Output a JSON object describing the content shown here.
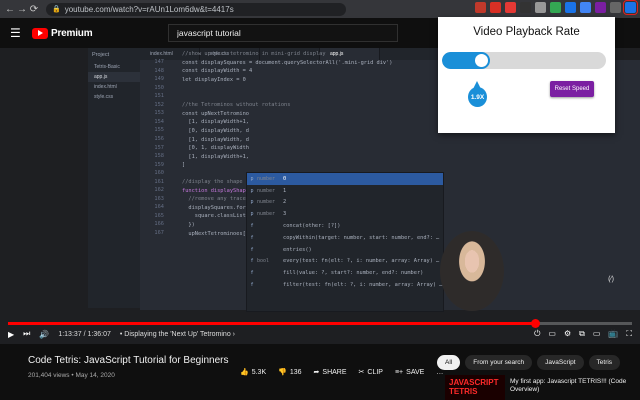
{
  "browser": {
    "url": "youtube.com/watch?v=rAUn1Lom6dw&t=4417s",
    "extensions": [
      {
        "icon": "shield-icon",
        "color": "#c0392b"
      },
      {
        "icon": "a-icon",
        "color": "#d93025"
      },
      {
        "icon": "triangle-icon",
        "color": "#e53935"
      },
      {
        "icon": "dark-reader-icon",
        "color": "#333333"
      },
      {
        "icon": "pen-icon",
        "color": "#999999"
      },
      {
        "icon": "puzzle-icon",
        "color": "#34a853"
      },
      {
        "icon": "grid-icon",
        "color": "#1a73e8"
      },
      {
        "icon": "bookmark-icon",
        "color": "#4285f4"
      },
      {
        "icon": "tab-icon",
        "color": "#7b1fa2"
      },
      {
        "icon": "dots-icon",
        "color": "#666666"
      },
      {
        "icon": "playback-rate-icon",
        "color": "#1a73e8"
      }
    ]
  },
  "youtube": {
    "brand": "Premium",
    "search_value": "javascript tutorial"
  },
  "ide": {
    "sidebar_header": "Project",
    "sidebar_items": [
      "Tetris-Basic",
      "app.js",
      "index.html",
      "style.css"
    ],
    "tabs": [
      "index.html",
      "style.css",
      "",
      "app.js"
    ],
    "line_numbers": [
      "147",
      "148",
      "149",
      "150",
      "151",
      "152",
      "153",
      "154",
      "155",
      "156",
      "157",
      "158",
      "159",
      "160",
      "161",
      "162",
      "163",
      "164",
      "165",
      "166",
      "167"
    ],
    "code_lines": [
      {
        "text": "//show up-next tetromino in mini-grid display",
        "cls": "cmt"
      },
      {
        "text": "const displaySquares = document.querySelectorAll('.mini-grid div')",
        "cls": ""
      },
      {
        "text": "const displayWidth = 4",
        "cls": ""
      },
      {
        "text": "let displayIndex = 0",
        "cls": ""
      },
      {
        "text": "",
        "cls": ""
      },
      {
        "text": "",
        "cls": ""
      },
      {
        "text": "//the Tetrominos without rotations",
        "cls": "cmt"
      },
      {
        "text": "const upNextTetromino",
        "cls": ""
      },
      {
        "text": "  [1, displayWidth+1,",
        "cls": ""
      },
      {
        "text": "  [0, displayWidth, d",
        "cls": ""
      },
      {
        "text": "  [1, displayWidth, d",
        "cls": ""
      },
      {
        "text": "  [0, 1, displayWidth",
        "cls": ""
      },
      {
        "text": "  [1, displayWidth+1,",
        "cls": ""
      },
      {
        "text": "]",
        "cls": ""
      },
      {
        "text": "",
        "cls": ""
      },
      {
        "text": "//display the shape i",
        "cls": "cmt"
      },
      {
        "text": "function displayShape",
        "cls": "kw"
      },
      {
        "text": "  //remove any trace",
        "cls": "cmt"
      },
      {
        "text": "  displaySquares.for",
        "cls": ""
      },
      {
        "text": "    square.classList.",
        "cls": ""
      },
      {
        "text": "  })",
        "cls": ""
      },
      {
        "text": "  upNextTetrominoes[nextRandom].f",
        "cls": ""
      }
    ],
    "autocomplete": [
      {
        "badge": "p",
        "type": "number",
        "text": "0",
        "selected": true
      },
      {
        "badge": "p",
        "type": "number",
        "text": "1",
        "selected": false
      },
      {
        "badge": "p",
        "type": "number",
        "text": "2",
        "selected": false
      },
      {
        "badge": "p",
        "type": "number",
        "text": "3",
        "selected": false
      },
      {
        "badge": "f",
        "type": "",
        "text": "concat(other: [?])",
        "selected": false
      },
      {
        "badge": "f",
        "type": "",
        "text": "copyWithin(target: number, start: number, end?: …",
        "selected": false
      },
      {
        "badge": "f",
        "type": "",
        "text": "entries()",
        "selected": false
      },
      {
        "badge": "f",
        "type": "bool",
        "text": "every(test: fn(elt: ?, i: number, array: Array) …",
        "selected": false
      },
      {
        "badge": "f",
        "type": "",
        "text": "fill(value: ?, start?: number, end?: number)",
        "selected": false
      },
      {
        "badge": "f",
        "type": "",
        "text": "filter(test: fn(elt: ?, i: number, array: Array) …",
        "selected": false
      }
    ]
  },
  "player": {
    "progress": 0.845,
    "current_time": "1:13:37",
    "duration": "1:36:07",
    "chapter": "Displaying the 'Next Up' Tetromino"
  },
  "video": {
    "title": "Code Tetris: JavaScript Tutorial for Beginners",
    "meta": "201,404 views • May 14, 2020",
    "likes": "5.3K",
    "dislikes": "136",
    "share": "SHARE",
    "clip": "CLIP",
    "save": "SAVE"
  },
  "chips": [
    "All",
    "From your search",
    "JavaScript",
    "Tetris"
  ],
  "recommendation": {
    "thumb_text": "JAVASCRIPT TETRIS",
    "title": "My first app: Javascript TETRIS!!! (Code Overview)"
  },
  "popup": {
    "title": "Video Playback Rate",
    "rate_label": "1.9X",
    "slider_value": 0.19,
    "reset_label": "Reset Speed"
  }
}
